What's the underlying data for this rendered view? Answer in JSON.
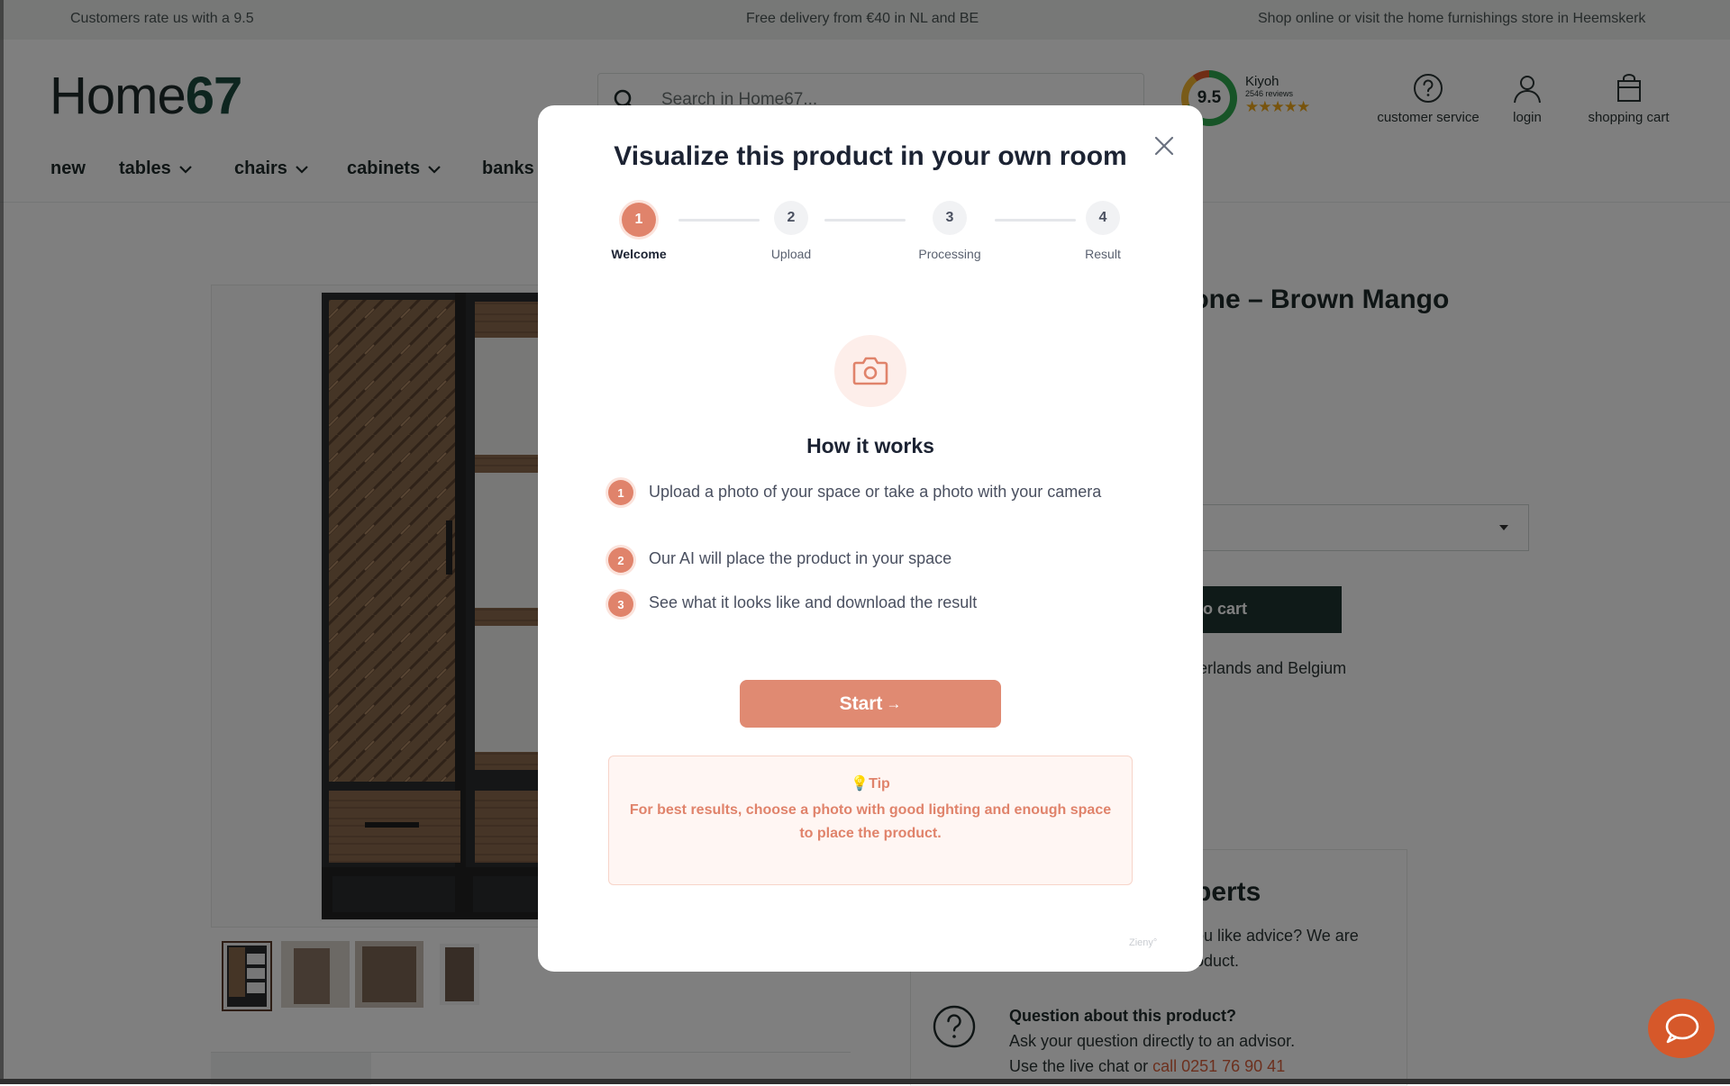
{
  "topbar": {
    "left": "Customers rate us with a 9.5",
    "center": "Free delivery from €40 in NL and BE",
    "right": "Shop online or visit the home furnishings store in Heemskerk"
  },
  "header": {
    "logo_home": "Home",
    "logo_num": "67",
    "search_placeholder": "Search in Home67...",
    "kiyoh": {
      "score": "9.5",
      "name": "Kiyoh",
      "reviews": "2546 reviews",
      "stars": "★★★★★"
    },
    "customer_service": "customer service",
    "login": "login",
    "cart": "shopping cart"
  },
  "nav": {
    "items": [
      "new",
      "tables",
      "chairs",
      "cabinets",
      "banks"
    ]
  },
  "product": {
    "title_partial": "pone – Brown Mango",
    "cart_button_partial": "o cart",
    "delivery_partial": "herlands and Belgium"
  },
  "experts": {
    "heading_partial": "perts",
    "text_line1": "ou like advice? We are",
    "text_line2": "oduct.",
    "question_title": "Question about this product?",
    "question_line1": "Ask your question directly to an advisor.",
    "question_line2_prefix": "Use the live chat or ",
    "question_line2_link": "call 0251 76 90 41"
  },
  "modal": {
    "title": "Visualize this product in your own room",
    "steps": [
      {
        "num": "1",
        "label": "Welcome"
      },
      {
        "num": "2",
        "label": "Upload"
      },
      {
        "num": "3",
        "label": "Processing"
      },
      {
        "num": "4",
        "label": "Result"
      }
    ],
    "how_heading": "How it works",
    "list": [
      {
        "num": "1",
        "text": "Upload a photo of your space or take a photo with your camera"
      },
      {
        "num": "2",
        "text": "Our AI will place the product in your space"
      },
      {
        "num": "3",
        "text": "See what it looks like and download the result"
      }
    ],
    "start_label": "Start",
    "start_arrow": "→",
    "tip_heading": "💡Tip",
    "tip_text": "For best results, choose a photo with good lighting and enough space to place the product.",
    "brand": "Zieny°"
  },
  "colors": {
    "accent": "#e0836b",
    "accent_light": "#fdeeea",
    "brand_dark": "#1d4a3e",
    "chat": "#d6582a"
  },
  "icons": [
    "search-icon",
    "question-icon",
    "user-icon",
    "bag-icon",
    "chevron-down-icon",
    "close-icon",
    "camera-icon",
    "chat-icon",
    "arrow-right-icon"
  ]
}
